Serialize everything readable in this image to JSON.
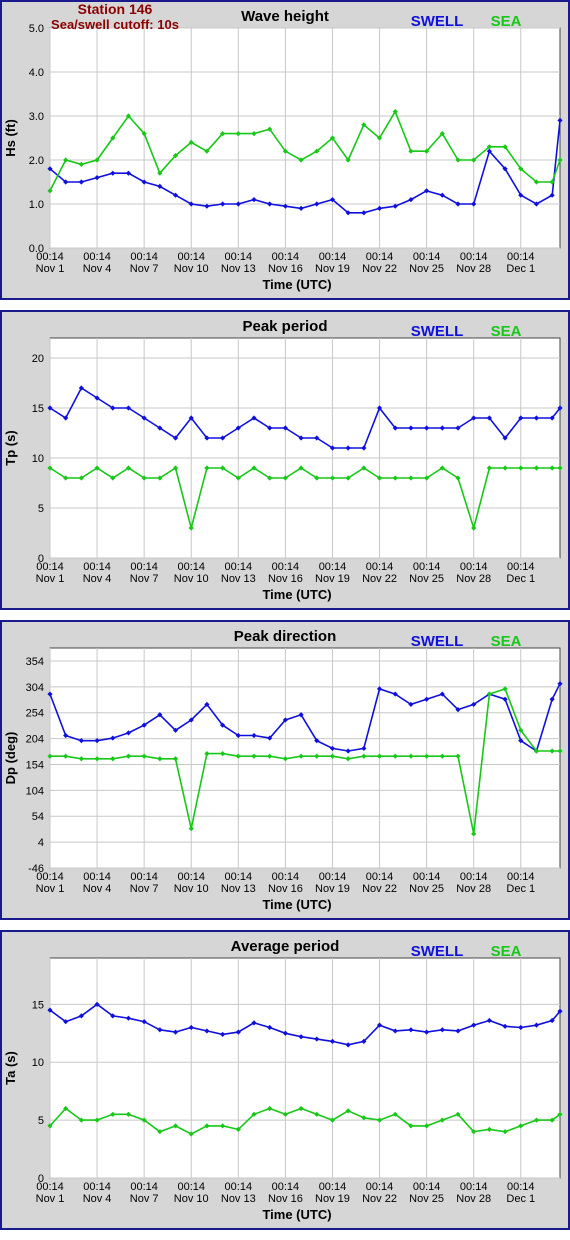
{
  "header": {
    "station": "Station 146",
    "cutoff": "Sea/swell cutoff: 10s"
  },
  "colors": {
    "swell": "#1010dd",
    "sea": "#18c818",
    "plot_bg": "#d6d6d6",
    "frame": "#1a1a8c",
    "header_text": "#8b0000"
  },
  "legend": {
    "swell": "SWELL",
    "sea": "SEA"
  },
  "x_ticks": [
    {
      "time": "00:14",
      "date": "Nov 1"
    },
    {
      "time": "00:14",
      "date": "Nov 4"
    },
    {
      "time": "00:14",
      "date": "Nov 7"
    },
    {
      "time": "00:14",
      "date": "Nov 10"
    },
    {
      "time": "00:14",
      "date": "Nov 13"
    },
    {
      "time": "00:14",
      "date": "Nov 16"
    },
    {
      "time": "00:14",
      "date": "Nov 19"
    },
    {
      "time": "00:14",
      "date": "Nov 22"
    },
    {
      "time": "00:14",
      "date": "Nov 25"
    },
    {
      "time": "00:14",
      "date": "Nov 28"
    },
    {
      "time": "00:14",
      "date": "Dec 1"
    }
  ],
  "chart_data": [
    {
      "type": "line",
      "title": "Wave height",
      "xlabel": "Time (UTC)",
      "ylabel": "Hs (ft)",
      "x_range_days": [
        0,
        32.5
      ],
      "ylim": [
        0,
        5
      ],
      "yticks": [
        0.0,
        1.0,
        2.0,
        3.0,
        4.0,
        5.0
      ],
      "ytick_labels": [
        "0.0",
        "1.0",
        "2.0",
        "3.0",
        "4.0",
        "5.0"
      ],
      "grid": true,
      "legend": "top-right",
      "series": [
        {
          "name": "SWELL",
          "x_day": [
            0,
            1,
            2,
            3,
            4,
            5,
            6,
            7,
            8,
            9,
            10,
            11,
            12,
            13,
            14,
            15,
            16,
            17,
            18,
            19,
            20,
            21,
            22,
            23,
            24,
            25,
            26,
            27,
            28,
            29,
            30,
            31,
            32,
            32.5
          ],
          "values": [
            1.8,
            1.5,
            1.5,
            1.6,
            1.7,
            1.7,
            1.5,
            1.4,
            1.2,
            1.0,
            0.95,
            1.0,
            1.0,
            1.1,
            1.0,
            0.95,
            0.9,
            1.0,
            1.1,
            0.8,
            0.8,
            0.9,
            0.95,
            1.1,
            1.3,
            1.2,
            1.0,
            1.0,
            2.2,
            1.8,
            1.2,
            1.0,
            1.2,
            2.9
          ]
        },
        {
          "name": "SEA",
          "x_day": [
            0,
            1,
            2,
            3,
            4,
            5,
            6,
            7,
            8,
            9,
            10,
            11,
            12,
            13,
            14,
            15,
            16,
            17,
            18,
            19,
            20,
            21,
            22,
            23,
            24,
            25,
            26,
            27,
            28,
            29,
            30,
            31,
            32,
            32.5
          ],
          "values": [
            1.3,
            2.0,
            1.9,
            2.0,
            2.5,
            3.0,
            2.6,
            1.7,
            2.1,
            2.4,
            2.2,
            2.6,
            2.6,
            2.6,
            2.7,
            2.2,
            2.0,
            2.2,
            2.5,
            2.0,
            2.8,
            2.5,
            3.1,
            2.2,
            2.2,
            2.6,
            2.0,
            2.0,
            2.3,
            2.3,
            1.8,
            1.5,
            1.5,
            2.0
          ]
        }
      ]
    },
    {
      "type": "line",
      "title": "Peak period",
      "xlabel": "Time (UTC)",
      "ylabel": "Tp (s)",
      "x_range_days": [
        0,
        32.5
      ],
      "ylim": [
        0,
        22
      ],
      "yticks": [
        0,
        5,
        10,
        15,
        20
      ],
      "ytick_labels": [
        "0",
        "5",
        "10",
        "15",
        "20"
      ],
      "grid": true,
      "legend": "top-right",
      "series": [
        {
          "name": "SWELL",
          "x_day": [
            0,
            1,
            2,
            3,
            4,
            5,
            6,
            7,
            8,
            9,
            10,
            11,
            12,
            13,
            14,
            15,
            16,
            17,
            18,
            19,
            20,
            21,
            22,
            23,
            24,
            25,
            26,
            27,
            28,
            29,
            30,
            31,
            32,
            32.5
          ],
          "values": [
            15,
            14,
            17,
            16,
            15,
            15,
            14,
            13,
            12,
            14,
            12,
            12,
            13,
            14,
            13,
            13,
            12,
            12,
            11,
            11,
            11,
            15,
            13,
            13,
            13,
            13,
            13,
            14,
            14,
            12,
            14,
            14,
            14,
            15
          ]
        },
        {
          "name": "SEA",
          "x_day": [
            0,
            1,
            2,
            3,
            4,
            5,
            6,
            7,
            8,
            9,
            10,
            11,
            12,
            13,
            14,
            15,
            16,
            17,
            18,
            19,
            20,
            21,
            22,
            23,
            24,
            25,
            26,
            27,
            28,
            29,
            30,
            31,
            32,
            32.5
          ],
          "values": [
            9,
            8,
            8,
            9,
            8,
            9,
            8,
            8,
            9,
            3,
            9,
            9,
            8,
            9,
            8,
            8,
            9,
            8,
            8,
            8,
            9,
            8,
            8,
            8,
            8,
            9,
            8,
            3,
            9,
            9,
            9,
            9,
            9,
            9
          ]
        }
      ]
    },
    {
      "type": "line",
      "title": "Peak direction",
      "xlabel": "Time (UTC)",
      "ylabel": "Dp (deg)",
      "x_range_days": [
        0,
        32.5
      ],
      "ylim": [
        -46,
        379
      ],
      "yticks": [
        -46,
        4,
        54,
        104,
        154,
        204,
        254,
        304,
        354
      ],
      "ytick_labels": [
        "-46",
        "4",
        "54",
        "104",
        "154",
        "204",
        "254",
        "304",
        "354"
      ],
      "grid": true,
      "legend": "top-right",
      "series": [
        {
          "name": "SWELL",
          "x_day": [
            0,
            1,
            2,
            3,
            4,
            5,
            6,
            7,
            8,
            9,
            10,
            11,
            12,
            13,
            14,
            15,
            16,
            17,
            18,
            19,
            20,
            21,
            22,
            23,
            24,
            25,
            26,
            27,
            28,
            29,
            30,
            31,
            32,
            32.5
          ],
          "values": [
            290,
            210,
            200,
            200,
            205,
            215,
            230,
            250,
            220,
            240,
            270,
            230,
            210,
            210,
            205,
            240,
            250,
            200,
            185,
            180,
            185,
            300,
            290,
            270,
            280,
            290,
            260,
            270,
            290,
            280,
            200,
            180,
            280,
            310
          ]
        },
        {
          "name": "SEA",
          "x_day": [
            0,
            1,
            2,
            3,
            4,
            5,
            6,
            7,
            8,
            9,
            10,
            11,
            12,
            13,
            14,
            15,
            16,
            17,
            18,
            19,
            20,
            21,
            22,
            23,
            24,
            25,
            26,
            27,
            28,
            29,
            30,
            31,
            32,
            32.5
          ],
          "values": [
            170,
            170,
            165,
            165,
            165,
            170,
            170,
            165,
            165,
            30,
            175,
            175,
            170,
            170,
            170,
            165,
            170,
            170,
            170,
            165,
            170,
            170,
            170,
            170,
            170,
            170,
            170,
            20,
            290,
            300,
            220,
            180,
            180,
            180
          ]
        }
      ]
    },
    {
      "type": "line",
      "title": "Average period",
      "xlabel": "Time (UTC)",
      "ylabel": "Ta (s)",
      "x_range_days": [
        0,
        32.5
      ],
      "ylim": [
        0,
        19
      ],
      "yticks": [
        0,
        5,
        10,
        15
      ],
      "ytick_labels": [
        "0",
        "5",
        "10",
        "15"
      ],
      "grid": true,
      "legend": "top-right",
      "series": [
        {
          "name": "SWELL",
          "x_day": [
            0,
            1,
            2,
            3,
            4,
            5,
            6,
            7,
            8,
            9,
            10,
            11,
            12,
            13,
            14,
            15,
            16,
            17,
            18,
            19,
            20,
            21,
            22,
            23,
            24,
            25,
            26,
            27,
            28,
            29,
            30,
            31,
            32,
            32.5
          ],
          "values": [
            14.5,
            13.5,
            14,
            15,
            14,
            13.8,
            13.5,
            12.8,
            12.6,
            13,
            12.7,
            12.4,
            12.6,
            13.4,
            13,
            12.5,
            12.2,
            12,
            11.8,
            11.5,
            11.8,
            13.2,
            12.7,
            12.8,
            12.6,
            12.8,
            12.7,
            13.2,
            13.6,
            13.1,
            13,
            13.2,
            13.6,
            14.4
          ]
        },
        {
          "name": "SEA",
          "x_day": [
            0,
            1,
            2,
            3,
            4,
            5,
            6,
            7,
            8,
            9,
            10,
            11,
            12,
            13,
            14,
            15,
            16,
            17,
            18,
            19,
            20,
            21,
            22,
            23,
            24,
            25,
            26,
            27,
            28,
            29,
            30,
            31,
            32,
            32.5
          ],
          "values": [
            4.5,
            6,
            5,
            5,
            5.5,
            5.5,
            5,
            4,
            4.5,
            3.8,
            4.5,
            4.5,
            4.2,
            5.5,
            6,
            5.5,
            6,
            5.5,
            5,
            5.8,
            5.2,
            5,
            5.5,
            4.5,
            4.5,
            5,
            5.5,
            4,
            4.2,
            4,
            4.5,
            5,
            5,
            5.5
          ]
        }
      ]
    }
  ]
}
